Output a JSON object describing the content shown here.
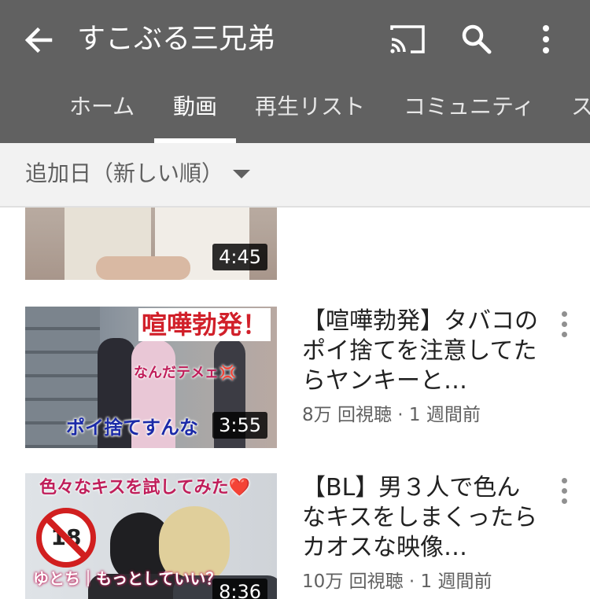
{
  "header": {
    "title": "すこぶる三兄弟",
    "back_icon": "arrow-left-icon",
    "cast_icon": "cast-icon",
    "search_icon": "search-icon",
    "more_icon": "more-vert-icon"
  },
  "tabs": [
    {
      "label": "ホーム",
      "active": false
    },
    {
      "label": "動画",
      "active": true
    },
    {
      "label": "再生リスト",
      "active": false
    },
    {
      "label": "コミュニティ",
      "active": false
    },
    {
      "label": "ス",
      "active": false
    }
  ],
  "sort": {
    "label": "追加日（新しい順）",
    "caret_icon": "caret-down-icon"
  },
  "videos": [
    {
      "title": "",
      "duration": "4:45",
      "meta": ""
    },
    {
      "title": "【喧嘩勃発】タバコのポイ捨てを注意してたらヤンキーと…",
      "duration": "3:55",
      "meta": "8万 回視聴 · 1 週間前",
      "thumb_caption_top": "喧嘩勃発！",
      "thumb_caption_mid": "なんだテメェ💢",
      "thumb_caption_bottom": "ポイ捨てすんな"
    },
    {
      "title": "【BL】男３人で色んなキスをしまくったらカオスな映像…",
      "duration": "8:36",
      "meta": "10万 回視聴 · 1 週間前",
      "thumb_caption_top": "色々なキスを試してみた❤️",
      "thumb_badge": "18",
      "thumb_caption_bottom": "ゆとち｜もっとしていい？"
    }
  ],
  "colors": {
    "appbar": "#616161",
    "sortbar": "#f2f2f2",
    "title_text": "#212121",
    "meta_text": "#606060"
  }
}
